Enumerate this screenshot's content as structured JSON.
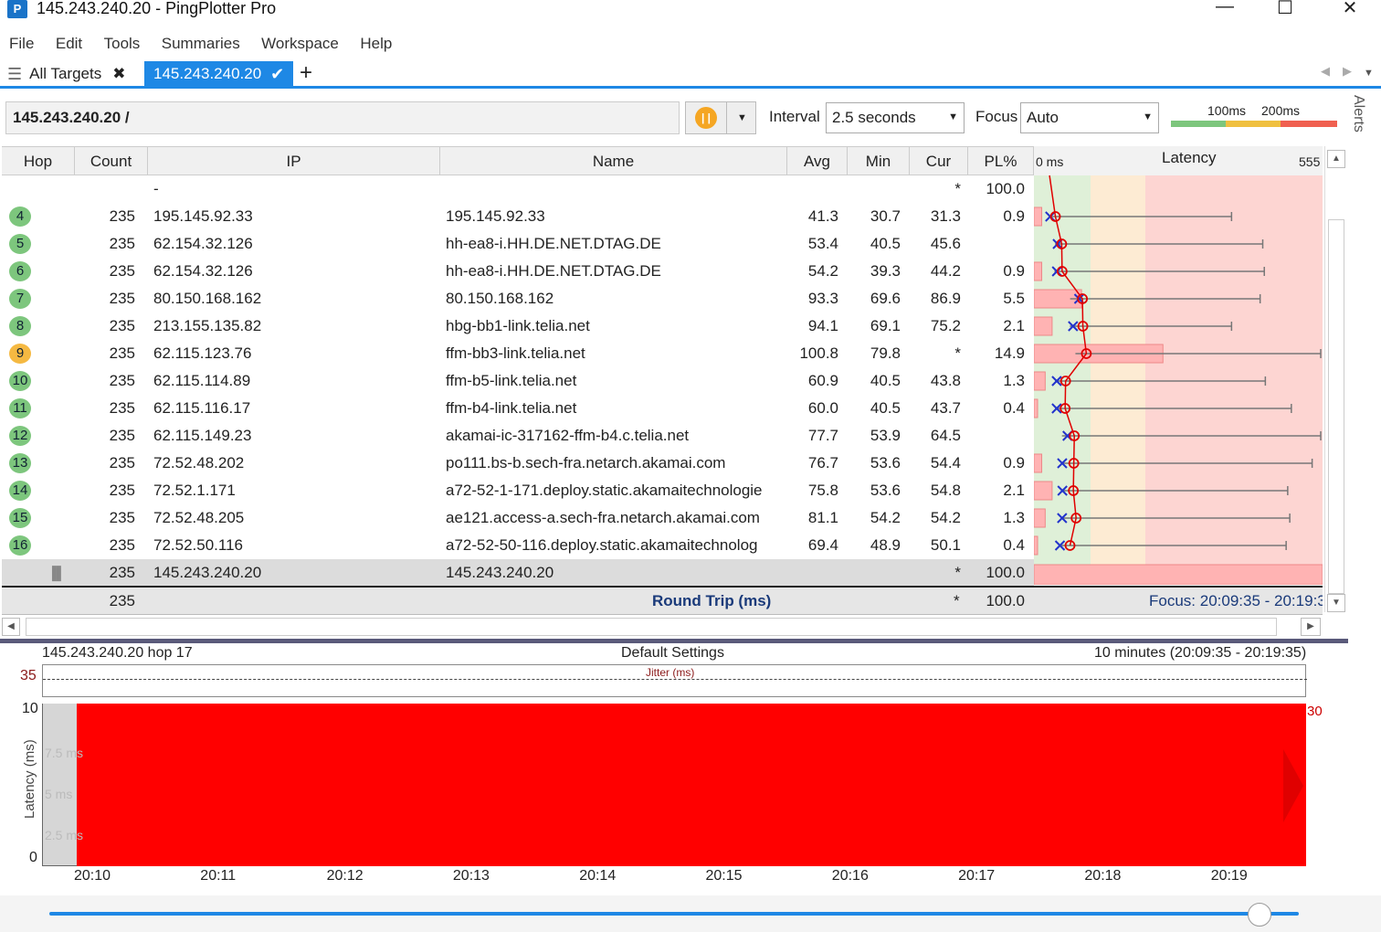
{
  "window": {
    "title": "145.243.240.20 - PingPlotter Pro",
    "app_icon": "P"
  },
  "menu": [
    "File",
    "Edit",
    "Tools",
    "Summaries",
    "Workspace",
    "Help"
  ],
  "tabs": {
    "all_targets": "All Targets",
    "active": "145.243.240.20"
  },
  "toolbar": {
    "address": "145.243.240.20 /",
    "interval_label": "Interval",
    "interval_value": "2.5 seconds",
    "focus_label": "Focus",
    "focus_value": "Auto",
    "scale_100": "100ms",
    "scale_200": "200ms"
  },
  "alerts_label": "Alerts",
  "columns": [
    "Hop",
    "Count",
    "IP",
    "Name",
    "Avg",
    "Min",
    "Cur",
    "PL%"
  ],
  "latency_header": {
    "zero": "0 ms",
    "title": "Latency",
    "max": "555"
  },
  "rows": [
    {
      "hop": "",
      "count": "",
      "ip": "-",
      "name": "",
      "avg": "",
      "min": "",
      "cur": "*",
      "pl": "100.0",
      "status": "none"
    },
    {
      "hop": "4",
      "count": "235",
      "ip": "195.145.92.33",
      "name": "195.145.92.33",
      "avg": "41.3",
      "min": "30.7",
      "cur": "31.3",
      "pl": "0.9",
      "status": "ok"
    },
    {
      "hop": "5",
      "count": "235",
      "ip": "62.154.32.126",
      "name": "hh-ea8-i.HH.DE.NET.DTAG.DE",
      "avg": "53.4",
      "min": "40.5",
      "cur": "45.6",
      "pl": "",
      "status": "ok"
    },
    {
      "hop": "6",
      "count": "235",
      "ip": "62.154.32.126",
      "name": "hh-ea8-i.HH.DE.NET.DTAG.DE",
      "avg": "54.2",
      "min": "39.3",
      "cur": "44.2",
      "pl": "0.9",
      "status": "ok"
    },
    {
      "hop": "7",
      "count": "235",
      "ip": "80.150.168.162",
      "name": "80.150.168.162",
      "avg": "93.3",
      "min": "69.6",
      "cur": "86.9",
      "pl": "5.5",
      "status": "ok"
    },
    {
      "hop": "8",
      "count": "235",
      "ip": "213.155.135.82",
      "name": "hbg-bb1-link.telia.net",
      "avg": "94.1",
      "min": "69.1",
      "cur": "75.2",
      "pl": "2.1",
      "status": "ok"
    },
    {
      "hop": "9",
      "count": "235",
      "ip": "62.115.123.76",
      "name": "ffm-bb3-link.telia.net",
      "avg": "100.8",
      "min": "79.8",
      "cur": "*",
      "pl": "14.9",
      "status": "warn"
    },
    {
      "hop": "10",
      "count": "235",
      "ip": "62.115.114.89",
      "name": "ffm-b5-link.telia.net",
      "avg": "60.9",
      "min": "40.5",
      "cur": "43.8",
      "pl": "1.3",
      "status": "ok"
    },
    {
      "hop": "11",
      "count": "235",
      "ip": "62.115.116.17",
      "name": "ffm-b4-link.telia.net",
      "avg": "60.0",
      "min": "40.5",
      "cur": "43.7",
      "pl": "0.4",
      "status": "ok"
    },
    {
      "hop": "12",
      "count": "235",
      "ip": "62.115.149.23",
      "name": "akamai-ic-317162-ffm-b4.c.telia.net",
      "avg": "77.7",
      "min": "53.9",
      "cur": "64.5",
      "pl": "",
      "status": "ok"
    },
    {
      "hop": "13",
      "count": "235",
      "ip": "72.52.48.202",
      "name": "po111.bs-b.sech-fra.netarch.akamai.com",
      "avg": "76.7",
      "min": "53.6",
      "cur": "54.4",
      "pl": "0.9",
      "status": "ok"
    },
    {
      "hop": "14",
      "count": "235",
      "ip": "72.52.1.171",
      "name": "a72-52-1-171.deploy.static.akamaitechnologie",
      "avg": "75.8",
      "min": "53.6",
      "cur": "54.8",
      "pl": "2.1",
      "status": "ok"
    },
    {
      "hop": "15",
      "count": "235",
      "ip": "72.52.48.205",
      "name": "ae121.access-a.sech-fra.netarch.akamai.com",
      "avg": "81.1",
      "min": "54.2",
      "cur": "54.2",
      "pl": "1.3",
      "status": "ok"
    },
    {
      "hop": "16",
      "count": "235",
      "ip": "72.52.50.116",
      "name": "a72-52-50-116.deploy.static.akamaitechnolog",
      "avg": "69.4",
      "min": "48.9",
      "cur": "50.1",
      "pl": "0.4",
      "status": "ok"
    },
    {
      "hop": "",
      "count": "235",
      "ip": "145.243.240.20",
      "name": "145.243.240.20",
      "avg": "",
      "min": "",
      "cur": "*",
      "pl": "100.0",
      "status": "target"
    }
  ],
  "latency_marks": [
    {
      "avg": 41.3,
      "min": 30.7,
      "cur": 31.3,
      "max": 380,
      "pl": 0.9
    },
    {
      "avg": 53.4,
      "min": 40.5,
      "cur": 45.6,
      "max": 440,
      "pl": 0
    },
    {
      "avg": 54.2,
      "min": 39.3,
      "cur": 44.2,
      "max": 443,
      "pl": 0.9
    },
    {
      "avg": 93.3,
      "min": 69.6,
      "cur": 86.9,
      "max": 435,
      "pl": 5.5
    },
    {
      "avg": 94.1,
      "min": 69.1,
      "cur": 75.2,
      "max": 380,
      "pl": 2.1
    },
    {
      "avg": 100.8,
      "min": 79.8,
      "cur": null,
      "max": 552,
      "pl": 14.9
    },
    {
      "avg": 60.9,
      "min": 40.5,
      "cur": 43.8,
      "max": 445,
      "pl": 1.3
    },
    {
      "avg": 60.0,
      "min": 40.5,
      "cur": 43.7,
      "max": 495,
      "pl": 0.4
    },
    {
      "avg": 77.7,
      "min": 53.9,
      "cur": 64.5,
      "max": 555,
      "pl": 0
    },
    {
      "avg": 76.7,
      "min": 53.6,
      "cur": 54.4,
      "max": 535,
      "pl": 0.9
    },
    {
      "avg": 75.8,
      "min": 53.6,
      "cur": 54.8,
      "max": 488,
      "pl": 2.1
    },
    {
      "avg": 81.1,
      "min": 54.2,
      "cur": 54.2,
      "max": 492,
      "pl": 1.3
    },
    {
      "avg": 69.4,
      "min": 48.9,
      "cur": 50.1,
      "max": 485,
      "pl": 0.4
    }
  ],
  "footer_row": {
    "count": "235",
    "label": "Round Trip (ms)",
    "cur": "*",
    "pl": "100.0",
    "focus": "Focus: 20:09:35 - 20:19:3"
  },
  "bottom": {
    "left_title": "145.243.240.20 hop 17",
    "center_title": "Default Settings",
    "right_title": "10 minutes (20:09:35 - 20:19:35)",
    "jitter_max": "35",
    "jitter_label": "Jitter (ms)",
    "y_max": "10",
    "y_min": "0",
    "y_label": "Latency (ms)",
    "y_ticks": [
      "7.5 ms",
      "5 ms",
      "2.5 ms"
    ],
    "right_max": "30",
    "x_ticks": [
      "20:10",
      "20:11",
      "20:12",
      "20:13",
      "20:14",
      "20:15",
      "20:16",
      "20:17",
      "20:18",
      "20:19"
    ]
  },
  "colors": {
    "accent": "#1e88e5",
    "loss": "#ff0000",
    "ok": "#7dc67d",
    "warn": "#f5b942"
  }
}
